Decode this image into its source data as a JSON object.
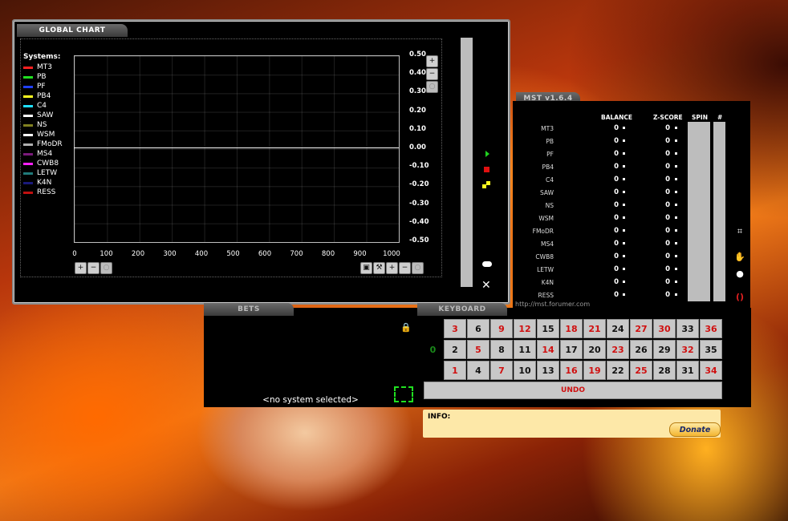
{
  "chart": {
    "title": "GLOBAL  CHART",
    "systems_label": "Systems:",
    "legend": [
      {
        "label": "MT3",
        "color": "#ff2020"
      },
      {
        "label": "PB",
        "color": "#20e020"
      },
      {
        "label": "PF",
        "color": "#2040ff"
      },
      {
        "label": "PB4",
        "color": "#ffff20"
      },
      {
        "label": "C4",
        "color": "#20e0ff"
      },
      {
        "label": "SAW",
        "color": "#ffffff"
      },
      {
        "label": "NS",
        "color": "#808020"
      },
      {
        "label": "WSM",
        "color": "#ffffff"
      },
      {
        "label": "FMoDR",
        "color": "#b0b0b0"
      },
      {
        "label": "MS4",
        "color": "#7a1a7a"
      },
      {
        "label": "CWB8",
        "color": "#ff20ff"
      },
      {
        "label": "LETW",
        "color": "#207a7a"
      },
      {
        "label": "K4N",
        "color": "#1a1a7a"
      },
      {
        "label": "RESS",
        "color": "#c01010"
      }
    ],
    "zoom_in_icon": "zoom-in-icon",
    "zoom_out_icon": "zoom-out-icon",
    "zoom_reset_icon": "zoom-reset-icon",
    "close": "✕"
  },
  "chart_data": {
    "type": "line",
    "x_ticks": [
      "0",
      "100",
      "200",
      "300",
      "400",
      "500",
      "600",
      "700",
      "800",
      "900",
      "1000"
    ],
    "y_ticks": [
      "0.50",
      "0.40",
      "0.30",
      "0.20",
      "0.10",
      "0.00",
      "-0.10",
      "-0.20",
      "-0.30",
      "-0.40",
      "-0.50"
    ],
    "xlim": [
      0,
      1000
    ],
    "ylim": [
      -0.5,
      0.5
    ],
    "grid": true,
    "legend_position": "left",
    "series": [
      {
        "name": "MT3",
        "values": []
      }
    ]
  },
  "mst": {
    "title": "MST v1.6.4",
    "headers": {
      "balance": "BALANCE",
      "zscore": "Z-SCORE",
      "spin": "SPIN",
      "hash": "#"
    },
    "rows": [
      {
        "name": "MT3",
        "balance": "0",
        "zscore": "0"
      },
      {
        "name": "PB",
        "balance": "0",
        "zscore": "0"
      },
      {
        "name": "PF",
        "balance": "0",
        "zscore": "0"
      },
      {
        "name": "PB4",
        "balance": "0",
        "zscore": "0"
      },
      {
        "name": "C4",
        "balance": "0",
        "zscore": "0"
      },
      {
        "name": "SAW",
        "balance": "0",
        "zscore": "0"
      },
      {
        "name": "NS",
        "balance": "0",
        "zscore": "0"
      },
      {
        "name": "WSM",
        "balance": "0",
        "zscore": "0"
      },
      {
        "name": "FMoDR",
        "balance": "0",
        "zscore": "0"
      },
      {
        "name": "MS4",
        "balance": "0",
        "zscore": "0"
      },
      {
        "name": "CWB8",
        "balance": "0",
        "zscore": "0"
      },
      {
        "name": "LETW",
        "balance": "0",
        "zscore": "0"
      },
      {
        "name": "K4N",
        "balance": "0",
        "zscore": "0"
      },
      {
        "name": "RESS",
        "balance": "0",
        "zscore": "0"
      }
    ],
    "url": "http://mst.forumer.com"
  },
  "bets": {
    "title": "BETS",
    "status": "<no system selected>"
  },
  "keyboard": {
    "title": "KEYBOARD",
    "zero": "0",
    "rows": [
      [
        {
          "n": "3",
          "c": "red"
        },
        {
          "n": "6",
          "c": "black"
        },
        {
          "n": "9",
          "c": "red"
        },
        {
          "n": "12",
          "c": "red"
        },
        {
          "n": "15",
          "c": "black"
        },
        {
          "n": "18",
          "c": "red"
        },
        {
          "n": "21",
          "c": "red"
        },
        {
          "n": "24",
          "c": "black"
        },
        {
          "n": "27",
          "c": "red"
        },
        {
          "n": "30",
          "c": "red"
        },
        {
          "n": "33",
          "c": "black"
        },
        {
          "n": "36",
          "c": "red"
        }
      ],
      [
        {
          "n": "2",
          "c": "black"
        },
        {
          "n": "5",
          "c": "red"
        },
        {
          "n": "8",
          "c": "black"
        },
        {
          "n": "11",
          "c": "black"
        },
        {
          "n": "14",
          "c": "red"
        },
        {
          "n": "17",
          "c": "black"
        },
        {
          "n": "20",
          "c": "black"
        },
        {
          "n": "23",
          "c": "red"
        },
        {
          "n": "26",
          "c": "black"
        },
        {
          "n": "29",
          "c": "black"
        },
        {
          "n": "32",
          "c": "red"
        },
        {
          "n": "35",
          "c": "black"
        }
      ],
      [
        {
          "n": "1",
          "c": "red"
        },
        {
          "n": "4",
          "c": "black"
        },
        {
          "n": "7",
          "c": "red"
        },
        {
          "n": "10",
          "c": "black"
        },
        {
          "n": "13",
          "c": "black"
        },
        {
          "n": "16",
          "c": "red"
        },
        {
          "n": "19",
          "c": "red"
        },
        {
          "n": "22",
          "c": "black"
        },
        {
          "n": "25",
          "c": "red"
        },
        {
          "n": "28",
          "c": "black"
        },
        {
          "n": "31",
          "c": "black"
        },
        {
          "n": "34",
          "c": "red"
        }
      ]
    ],
    "undo": "UNDO"
  },
  "info": {
    "label": "INFO:",
    "donate": "Donate"
  },
  "colors": {
    "red_number": "#d01010",
    "black_number": "#111111",
    "zero": "#1a8a1a",
    "info_bg": "#fde8a8"
  }
}
